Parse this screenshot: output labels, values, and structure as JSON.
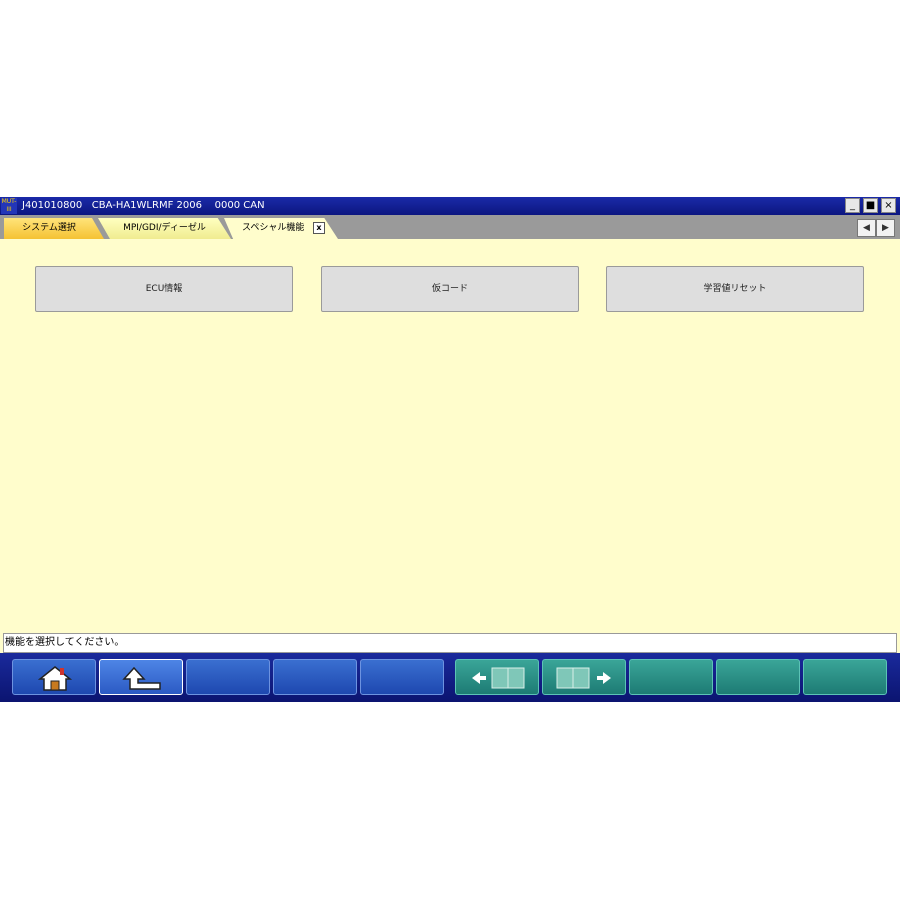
{
  "window": {
    "app_icon_text": "MUT-III",
    "title": "J401010800   CBA-HA1WLRMF 2006    0000 CAN",
    "controls": {
      "minimize": "_",
      "maximize": "■",
      "close": "×"
    }
  },
  "tabs": [
    {
      "label": "システム選択",
      "state": "visited"
    },
    {
      "label": "MPI/GDI/ディーゼル",
      "state": "visited"
    },
    {
      "label": "スペシャル機能",
      "state": "active",
      "close_label": "x"
    }
  ],
  "tab_scroll": {
    "left": "◀",
    "right": "▶"
  },
  "function_buttons": [
    {
      "label": "ECU情報"
    },
    {
      "label": "仮コード"
    },
    {
      "label": "学習値リセット"
    }
  ],
  "status": {
    "message": "機能を選択してください。"
  },
  "toolbar": {
    "buttons": [
      {
        "icon": "home-icon"
      },
      {
        "icon": "back-arrow-icon"
      },
      {
        "icon": ""
      },
      {
        "icon": ""
      },
      {
        "icon": ""
      },
      {
        "icon": "manual-prev-icon"
      },
      {
        "icon": "manual-next-icon"
      },
      {
        "icon": ""
      },
      {
        "icon": ""
      },
      {
        "icon": ""
      }
    ]
  },
  "colors": {
    "background": "#fffdcc",
    "title_bar": "#0c1680",
    "tab_active": "#fffdcc",
    "tab_visited": "#f5c233",
    "toolbar_blue": "#1e48b0",
    "toolbar_teal": "#1d7b74"
  }
}
